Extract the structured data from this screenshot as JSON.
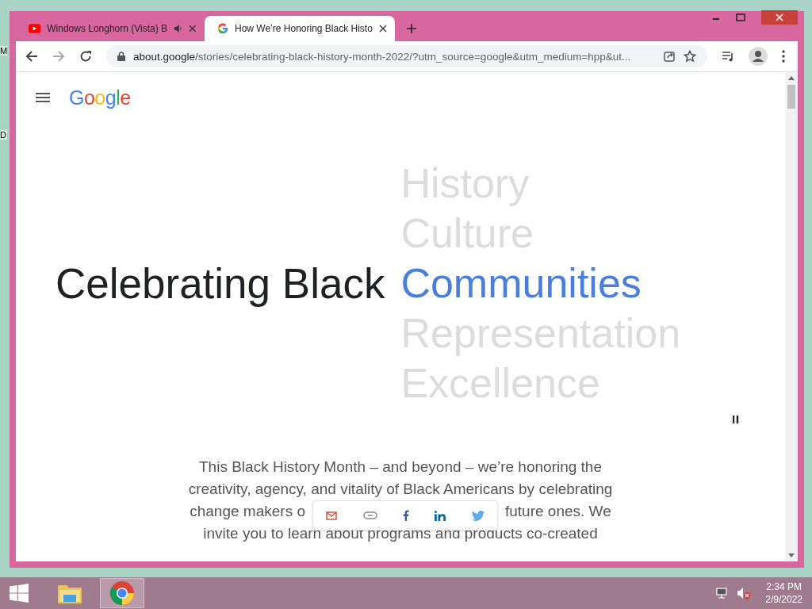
{
  "desktop_icons": [
    "M",
    "D"
  ],
  "tabs": [
    {
      "title": "Windows Longhorn (Vista) B",
      "kind": "video",
      "audio": true,
      "selected": false
    },
    {
      "title": "How We’re Honoring Black Histo",
      "kind": "google",
      "audio": false,
      "selected": true
    }
  ],
  "address_bar": {
    "host": "about.google",
    "path": "/stories/celebrating-black-history-month-2022/?utm_source=google&utm_medium=hpp&ut..."
  },
  "page": {
    "logo": "Google",
    "headline": "Celebrating Black",
    "words": [
      {
        "text": "History",
        "selected": false
      },
      {
        "text": "Culture",
        "selected": false
      },
      {
        "text": "Communities",
        "selected": true
      },
      {
        "text": "Representation",
        "selected": false
      },
      {
        "text": "Excellence",
        "selected": false
      }
    ],
    "paragraph_lines": [
      [
        "This Black History Month – and beyond – we’re honoring the"
      ],
      [
        "creativity, agency, and vitality of Black Americans by celebrating"
      ],
      [
        "change makers o",
        "future ones. We"
      ],
      [
        "invite you to learn about programs and products co-created"
      ]
    ]
  },
  "taskbar": {
    "time": "2:34 PM",
    "date": "2/9/2022"
  }
}
